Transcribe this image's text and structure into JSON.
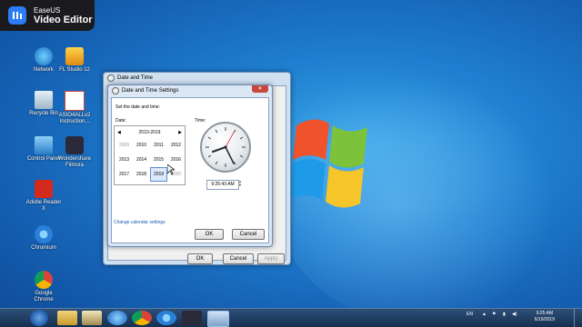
{
  "brand": {
    "top": "EaseUS",
    "bottom": "Video Editor"
  },
  "desktop_icons": [
    {
      "label": "Network",
      "icon": "network-icon"
    },
    {
      "label": "FL Studio 12",
      "icon": "fl-studio-icon"
    },
    {
      "label": "Recycle Bin",
      "icon": "recycle-bin-icon"
    },
    {
      "label": "ASIO4ALLv2 Instruction...",
      "icon": "document-icon"
    },
    {
      "label": "Control Panel",
      "icon": "control-panel-icon"
    },
    {
      "label": "Wondershare Filmora",
      "icon": "filmora-icon"
    },
    {
      "label": "Adobe Reader X",
      "icon": "adobe-reader-icon"
    },
    {
      "label": "Chromium",
      "icon": "chromium-icon"
    },
    {
      "label": "Google Chrome",
      "icon": "chrome-icon"
    }
  ],
  "outer_window": {
    "title": "Date and Time",
    "ok": "OK",
    "cancel": "Cancel",
    "apply": "Apply"
  },
  "inner_window": {
    "title": "Date and Time Settings",
    "instruction": "Set the date and time:",
    "date_label": "Date:",
    "time_label": "Time:",
    "calendar": {
      "range": "2010-2019",
      "years": [
        "2009",
        "2010",
        "2011",
        "2012",
        "2013",
        "2014",
        "2015",
        "2016",
        "2017",
        "2018",
        "2019",
        "2020"
      ],
      "selected": "2019"
    },
    "time_value": "9:25:43 AM",
    "link": "Change calendar settings",
    "ok": "OK",
    "cancel": "Cancel"
  },
  "taskbar": {
    "language": "EN",
    "time": "9:25 AM",
    "date": "6/19/2019"
  },
  "colors": {
    "accent": "#2b7cf6",
    "link": "#1b5eb7",
    "desktop": "#1f7fd0"
  }
}
